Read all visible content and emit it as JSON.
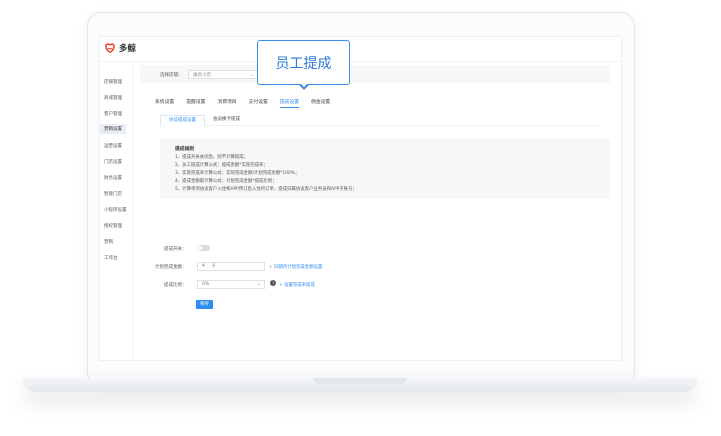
{
  "app": {
    "logo_text": "多鲸",
    "accent": "#2d8cf0"
  },
  "sidebar": {
    "items": [
      {
        "label": "店铺管理"
      },
      {
        "label": "商城管理"
      },
      {
        "label": "客户管理"
      },
      {
        "label": "营销设置"
      },
      {
        "label": "运营设置"
      },
      {
        "label": "门店设置"
      },
      {
        "label": "财务设置"
      },
      {
        "label": "智能门店"
      },
      {
        "label": "小程序设置"
      },
      {
        "label": "授权管理"
      },
      {
        "label": "营销"
      },
      {
        "label": "工作台"
      }
    ],
    "active_index": 3
  },
  "store": {
    "label": "选择店铺：",
    "value": "通云小店"
  },
  "tabs": [
    {
      "label": "系统设置"
    },
    {
      "label": "提醒设置"
    },
    {
      "label": "消费项目"
    },
    {
      "label": "支付设置"
    },
    {
      "label": "提成设置"
    },
    {
      "label": "佣金设置"
    }
  ],
  "active_tab": 4,
  "subtabs": [
    {
      "label": "协议提成设置"
    },
    {
      "label": "会员换卡提成"
    }
  ],
  "rules": {
    "title": "提成规则",
    "lines": [
      "1、提成开关关闭后，则不计算提成；",
      "2、员工提成计算公式：提成金额*实际完成率；",
      "3、实际完成率计算公式：实际完成金额/计划完成金额*100%；",
      "4、提成金额取计算公式：计划完成金额*提成比例；",
      "5、计算单项协议客户入住和APP预订后入住的订单，提成归属协议客户业务员和APP子账号；"
    ]
  },
  "form": {
    "switch_label": "提成开关：",
    "plan_label": "计划完成金额：",
    "plan_prefix": "¥",
    "plan_value": "0",
    "plan_link": "+ 同期月计划完成金额设置",
    "ratio_label": "提成比例：",
    "ratio_value": "0%",
    "ratio_link": "+ 设置完成率提成",
    "save_label": "保存"
  },
  "callout": {
    "text": "员工提成"
  }
}
